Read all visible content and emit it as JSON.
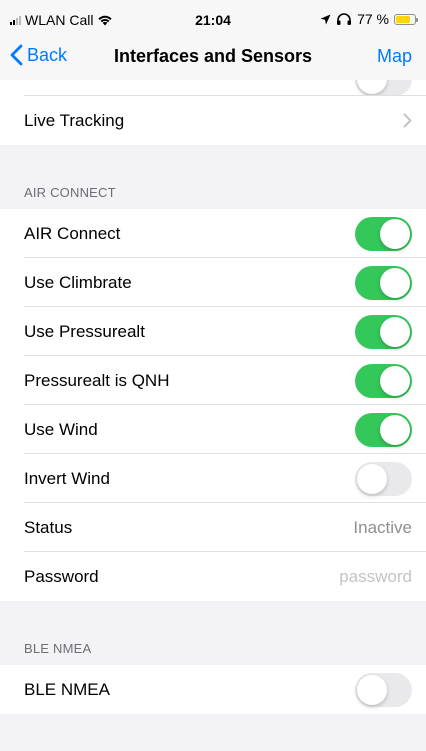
{
  "status_bar": {
    "carrier": "WLAN Call",
    "time": "21:04",
    "battery_percent": "77 %",
    "battery_level": 0.77,
    "battery_color": "#ffd60a"
  },
  "nav": {
    "back_label": "Back",
    "title": "Interfaces and Sensors",
    "map_label": "Map"
  },
  "top_group": {
    "live_tracking_label": "Live Tracking"
  },
  "air_connect": {
    "header": "AIR CONNECT",
    "rows": [
      {
        "label": "AIR Connect",
        "on": true
      },
      {
        "label": "Use Climbrate",
        "on": true
      },
      {
        "label": "Use Pressurealt",
        "on": true
      },
      {
        "label": "Pressurealt is QNH",
        "on": true
      },
      {
        "label": "Use Wind",
        "on": true
      },
      {
        "label": "Invert Wind",
        "on": false
      }
    ],
    "status_label": "Status",
    "status_value": "Inactive",
    "password_label": "Password",
    "password_placeholder": "password"
  },
  "ble_nmea": {
    "header": "BLE NMEA",
    "label": "BLE NMEA",
    "on": false
  },
  "colors": {
    "accent": "#007aff",
    "toggle_on": "#34c759",
    "toggle_off": "#e9e9eb"
  }
}
